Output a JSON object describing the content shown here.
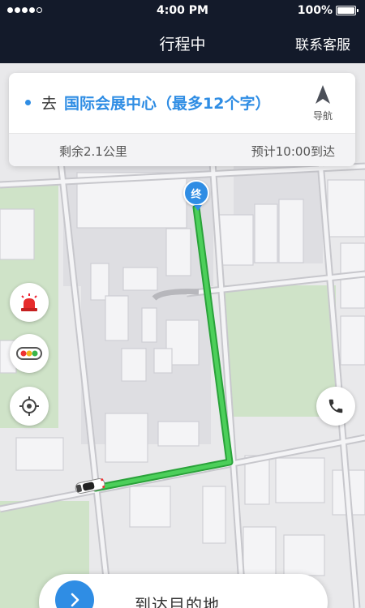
{
  "status_bar": {
    "signal_bars_filled": 4,
    "signal_bars_total": 5,
    "time": "4:00 PM",
    "battery": "100%"
  },
  "nav": {
    "title": "行程中",
    "right_action": "联系客服"
  },
  "card": {
    "prefix": "去",
    "destination": "国际会展中心（最多12个字）",
    "navigate_label": "导航",
    "remaining": "剩余2.1公里",
    "eta": "预计10:00到达"
  },
  "map": {
    "end_marker_label": "终",
    "route_color": "#3cc04b",
    "accent_color": "#2f8de4"
  },
  "buttons": {
    "alarm_icon": "alarm-light-icon",
    "traffic_icon": "traffic-light-icon",
    "locate_icon": "locate-icon",
    "phone_icon": "phone-icon"
  },
  "bottom": {
    "action_label": "到达目的地"
  }
}
